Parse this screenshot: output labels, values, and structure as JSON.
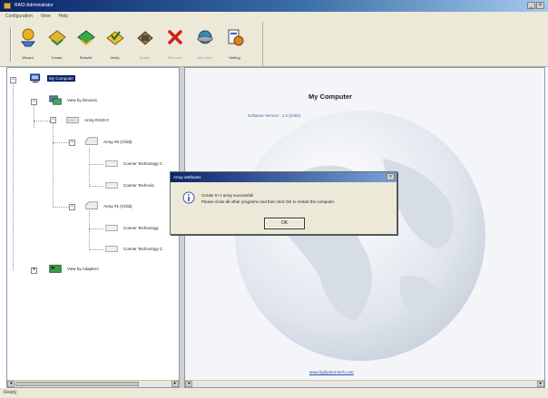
{
  "window": {
    "title": "RAID Administrator"
  },
  "menu": [
    "Configuration",
    "View",
    "Help"
  ],
  "toolbar": {
    "buttons": [
      {
        "label": "Wizard",
        "icon": "wizard-icon",
        "enabled": true
      },
      {
        "label": "Create",
        "icon": "create-array-icon",
        "enabled": true
      },
      {
        "label": "Rebuild",
        "icon": "rebuild-icon",
        "enabled": true
      },
      {
        "label": "Verify",
        "icon": "verify-icon",
        "enabled": true
      },
      {
        "label": "Delete",
        "icon": "delete-icon",
        "enabled": false
      },
      {
        "label": "Remove",
        "icon": "remove-icon",
        "enabled": false
      },
      {
        "label": "Add Disk",
        "icon": "add-disk-icon",
        "enabled": false
      },
      {
        "label": "Setting",
        "icon": "setting-icon",
        "enabled": true
      }
    ]
  },
  "tree": {
    "root": "My Computer",
    "devices": "View by Devices",
    "array": "Array RAID-0",
    "sub1": "Array #0 (Child)",
    "disk1": "Conner Technology C",
    "disk2": "Conner Technolo",
    "sub2": "Array #1 (Child)",
    "disk3": "Conner Technology",
    "disk4": "Conner Technology C",
    "adapters": "View by Adapters"
  },
  "content": {
    "title": "My Computer",
    "version": "Software Version : 1.0 (0482)",
    "link": "www.highpoint-tech.com"
  },
  "dialog": {
    "title": "Array attributes",
    "line1": "Create 0+1 array successful!",
    "line2": "Please close all other programs and then click OK to restart the computer.",
    "ok": "OK"
  },
  "status": "Ready",
  "colors": {
    "selection": "#0a246a",
    "titlebar": "#0a246a"
  }
}
